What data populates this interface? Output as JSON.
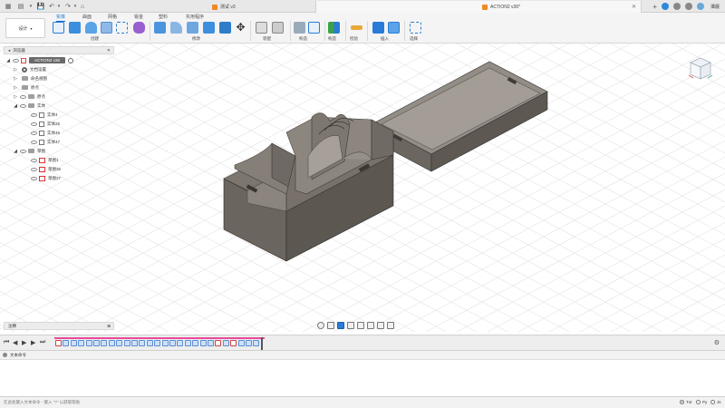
{
  "top_tabs": {
    "doc1": "测试 v3",
    "doc2": "ACTION2 v36*",
    "user": "谭晨"
  },
  "ribbon": {
    "design_label": "设计",
    "tabs": [
      "实体",
      "曲面",
      "网格",
      "钣金",
      "塑料",
      "实用程序"
    ],
    "groups": [
      "创建",
      "修改",
      "装配",
      "构造",
      "检验",
      "插入",
      "选择"
    ]
  },
  "browser": {
    "title": "浏览器",
    "root": "ACTION2 v36",
    "items": [
      {
        "label": "文档设置",
        "kind": "gear"
      },
      {
        "label": "命名视图",
        "kind": "folder"
      },
      {
        "label": "原点",
        "kind": "folder"
      },
      {
        "label": "实体",
        "kind": "folder"
      }
    ],
    "folders": {
      "origin": "原点",
      "bodies": "实体",
      "sketches": "草图"
    },
    "bodies": [
      "实体4",
      "实体26",
      "实体46",
      "实体47"
    ],
    "sketches": [
      "草图1",
      "草图36",
      "草图37"
    ]
  },
  "comments": {
    "label": "注释"
  },
  "text_commands": {
    "header": "文本命令",
    "placeholder": "在此处键入文本命令 - 键入 \"?\" 以获取帮助",
    "langs": [
      "Txt",
      "Py",
      "Js"
    ],
    "selected": "Txt"
  },
  "colors": {
    "accent": "#0b6bcb",
    "timeline_pink": "#e84a9a",
    "model_gray": "#5f5b55"
  }
}
